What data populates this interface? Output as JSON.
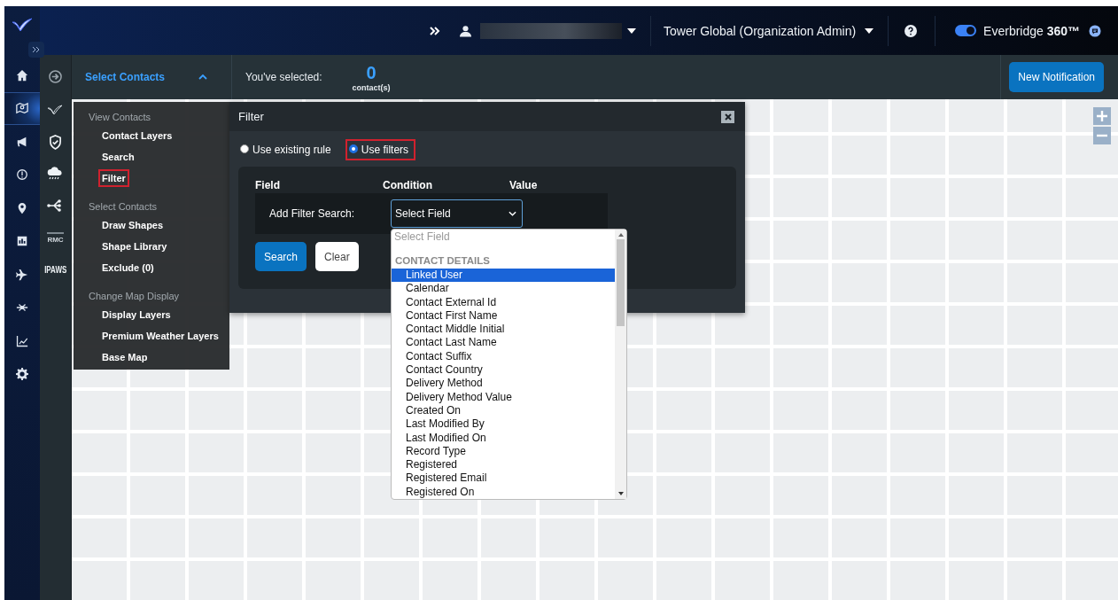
{
  "sidebar": {
    "items": [
      {
        "kind": "home",
        "selected": false
      },
      {
        "kind": "map",
        "selected": true
      },
      {
        "kind": "megaphone",
        "selected": false
      },
      {
        "kind": "alert",
        "selected": false
      },
      {
        "kind": "pin",
        "selected": false
      },
      {
        "kind": "report",
        "selected": false
      },
      {
        "kind": "plane",
        "selected": false
      },
      {
        "kind": "network",
        "selected": false
      },
      {
        "kind": "chart",
        "selected": false
      },
      {
        "kind": "gear",
        "selected": false
      }
    ]
  },
  "topbar": {
    "organization": "Tower Global (Organization Admin)",
    "toggle": {
      "on": true,
      "label": "Everbridge **360™**"
    }
  },
  "subbar": {
    "title": "Select Contacts",
    "expanded": true,
    "selected_label": "You've selected:",
    "count": "0",
    "count_unit": "contact(s)",
    "button": "New Notification"
  },
  "tools": [
    {
      "kind": "bird"
    },
    {
      "kind": "shield"
    },
    {
      "kind": "weather"
    },
    {
      "kind": "share"
    },
    {
      "kind": "rmc",
      "label": "RMC"
    },
    {
      "kind": "ipaws",
      "label": "IPAWS"
    }
  ],
  "menu": {
    "sections": [
      {
        "title": "View Contacts",
        "items": [
          {
            "label": "Contact Layers",
            "highlighted": false
          },
          {
            "label": "Search",
            "highlighted": false
          },
          {
            "label": "Filter",
            "highlighted": true
          }
        ]
      },
      {
        "title": "Select Contacts",
        "items": [
          {
            "label": "Draw Shapes",
            "highlighted": false
          },
          {
            "label": "Shape Library",
            "highlighted": false
          },
          {
            "label": "Exclude (0)",
            "highlighted": false
          }
        ]
      },
      {
        "title": "Change Map Display",
        "items": [
          {
            "label": "Display Layers",
            "highlighted": false
          },
          {
            "label": "Premium Weather Layers",
            "highlighted": false
          },
          {
            "label": "Base Map",
            "highlighted": false
          }
        ]
      }
    ]
  },
  "filter": {
    "title": "Filter",
    "options": [
      {
        "label": "Use existing rule",
        "selected": false,
        "highlighted": false
      },
      {
        "label": "Use filters",
        "selected": true,
        "highlighted": true
      }
    ],
    "columns": [
      "Field",
      "Condition",
      "Value"
    ],
    "row_label": "Add Filter Search:",
    "select": {
      "value": "Select Field",
      "open": true
    },
    "buttons": [
      {
        "label": "Search",
        "kind": "primary"
      },
      {
        "label": "Clear",
        "kind": "secondary"
      }
    ],
    "dropdown": {
      "placeholder": "Select Field",
      "groups": [
        {
          "title": "CONTACT DETAILS",
          "options": [
            {
              "label": "Linked User",
              "selected": true
            },
            {
              "label": "Calendar",
              "selected": false
            },
            {
              "label": "Contact External Id",
              "selected": false
            },
            {
              "label": "Contact First Name",
              "selected": false
            },
            {
              "label": "Contact Middle Initial",
              "selected": false
            },
            {
              "label": "Contact Last Name",
              "selected": false
            },
            {
              "label": "Contact Suffix",
              "selected": false
            },
            {
              "label": "Contact Country",
              "selected": false
            },
            {
              "label": "Delivery Method",
              "selected": false
            },
            {
              "label": "Delivery Method Value",
              "selected": false
            },
            {
              "label": "Created On",
              "selected": false
            },
            {
              "label": "Last Modified By",
              "selected": false
            },
            {
              "label": "Last Modified On",
              "selected": false
            },
            {
              "label": "Record Type",
              "selected": false
            },
            {
              "label": "Registered",
              "selected": false
            },
            {
              "label": "Registered Email",
              "selected": false
            },
            {
              "label": "Registered On",
              "selected": false
            }
          ]
        }
      ]
    }
  }
}
